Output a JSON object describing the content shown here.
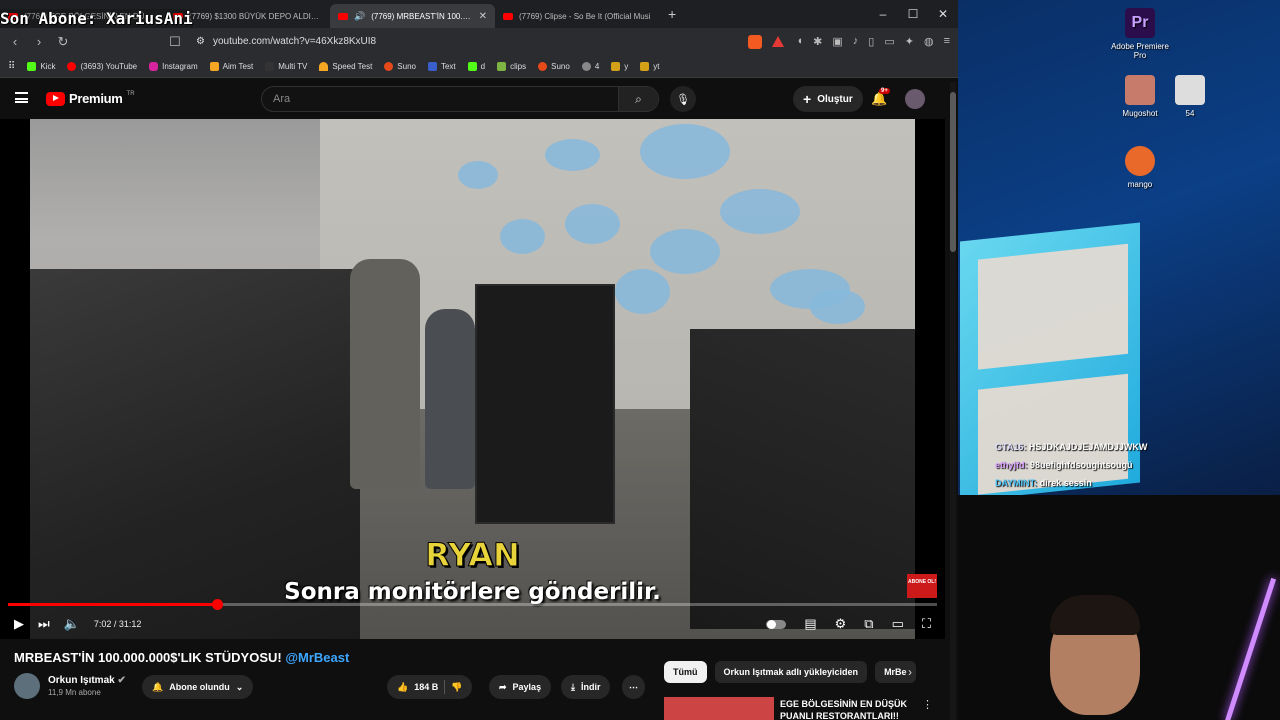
{
  "overlay": {
    "subscriber_text": "Son Abone: XariusAni"
  },
  "browser": {
    "tabs": [
      {
        "label": "(7769) EGE BÖLGESİNİN EN DÜŞÜK",
        "active": false
      },
      {
        "label": "(7769) $1300 BÜYÜK DEPO ALDIK BA",
        "active": false
      },
      {
        "label": "(7769) MRBEAST'İN 100.000.0",
        "active": true
      },
      {
        "label": "(7769) Clipse - So Be It (Official Musi",
        "active": false
      }
    ],
    "url": "youtube.com/watch?v=46Xkz8KxUI8",
    "bookmarks": [
      {
        "label": "Kick",
        "color": "#53fc18"
      },
      {
        "label": "(3693) YouTube",
        "color": "#ff0000"
      },
      {
        "label": "Instagram",
        "color": "#d6249f"
      },
      {
        "label": "Aim Test",
        "color": "#f5a623"
      },
      {
        "label": "Multi TV",
        "color": "#333333"
      },
      {
        "label": "Speed Test",
        "color": "#f5a623"
      },
      {
        "label": "Suno",
        "color": "#e64a19"
      },
      {
        "label": "Text",
        "color": "#3a5fcd"
      },
      {
        "label": "d",
        "color": "#53fc18"
      },
      {
        "label": "clips",
        "color": "#7cb342"
      },
      {
        "label": "Suno",
        "color": "#e64a19"
      },
      {
        "label": "4",
        "color": "#888888"
      },
      {
        "label": "y",
        "color": "#d4a017"
      },
      {
        "label": "yt",
        "color": "#d4a017"
      }
    ]
  },
  "youtube": {
    "brand": "Premium",
    "region": "TR",
    "search_placeholder": "Ara",
    "create_label": "Oluştur",
    "notif_count": "9+",
    "video": {
      "subtitle_name": "RYAN",
      "subtitle_line": "Sonra monitörlere gönderilir.",
      "badge_text": "ABONE OL!",
      "time": "7:02 / 31:12",
      "progress": 0.225
    },
    "title": "MRBEAST'İN 100.000.000$'LIK STÜDYOSU!",
    "title_mention": "@MrBeast",
    "channel": {
      "name": "Orkun Işıtmak",
      "subs": "11,9 Mn abone",
      "subscribe_label": "Abone olundu"
    },
    "actions": {
      "likes": "184 B",
      "share": "Paylaş",
      "download": "İndir"
    },
    "chips": [
      "Tümü",
      "Orkun Işıtmak adlı yükleyiciden",
      "MrBe"
    ],
    "recommended": {
      "title_line1": "EGE BÖLGESİNİN EN DÜŞÜK",
      "title_line2": "PUANLI RESTORANTLARI!!"
    }
  },
  "desktop": {
    "icons": [
      {
        "label": "Adobe Premiere Pro"
      },
      {
        "label": "Mugoshot"
      },
      {
        "label": "54"
      },
      {
        "label": "mango"
      }
    ],
    "chat": [
      {
        "user": "GTA16:",
        "text": "HSJDKAJDJEJAMDJJWKW",
        "color": "#e0e0ff"
      },
      {
        "user": "ethyjfd:",
        "text": "98uefighfdsoughtsougü",
        "color": "#d8a0ff"
      },
      {
        "user": "DAYMINT:",
        "text": "direk sessin",
        "color": "#4fc3f7"
      }
    ]
  }
}
